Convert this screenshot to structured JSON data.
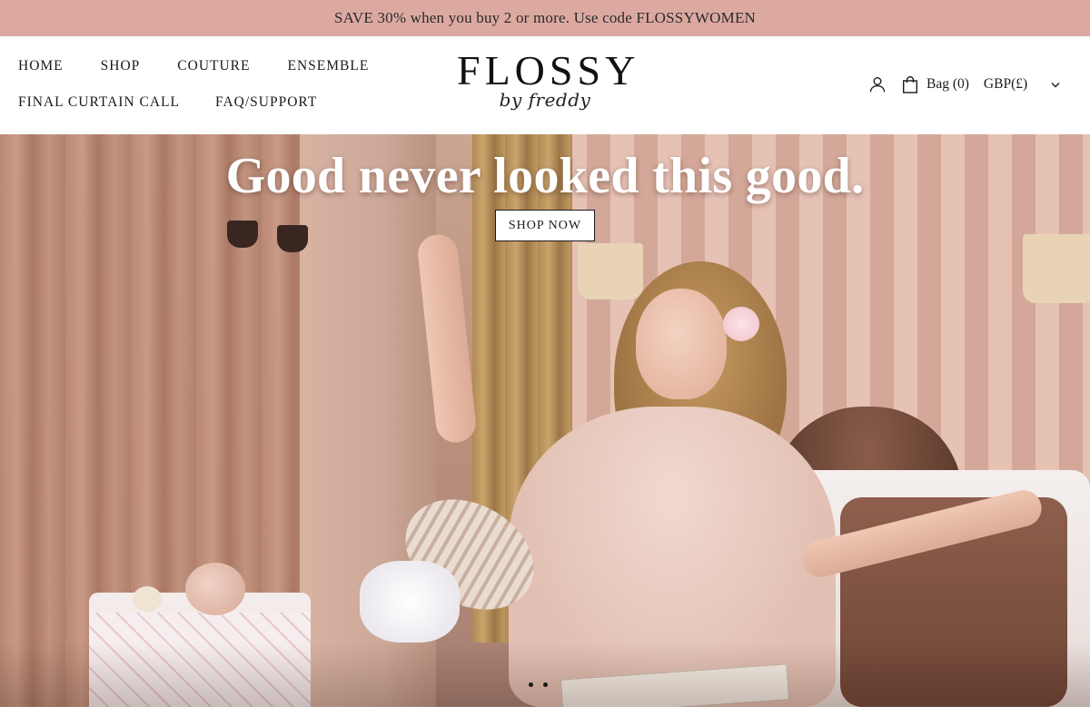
{
  "announcement": {
    "text": "SAVE 30% when you buy 2 or more. Use code FLOSSYWOMEN"
  },
  "nav": {
    "row1": [
      "HOME",
      "SHOP",
      "COUTURE",
      "ENSEMBLE"
    ],
    "row2": [
      "FINAL CURTAIN CALL",
      "FAQ/SUPPORT"
    ]
  },
  "logo": {
    "main": "FLOSSY",
    "sub": "by freddy"
  },
  "utilities": {
    "account_icon": "user-icon",
    "bag_icon": "shopping-bag-icon",
    "bag_label": "Bag (0)",
    "currency": "GBP(£)",
    "currency_icon": "chevron-down-icon"
  },
  "hero": {
    "title": "Good never looked this good.",
    "cta": "SHOP NOW",
    "slides": 2,
    "active_slide": 1
  },
  "colors": {
    "announcement_bg": "#dca9a1",
    "text": "#1a1a1a",
    "hero_title": "#ffffff"
  }
}
